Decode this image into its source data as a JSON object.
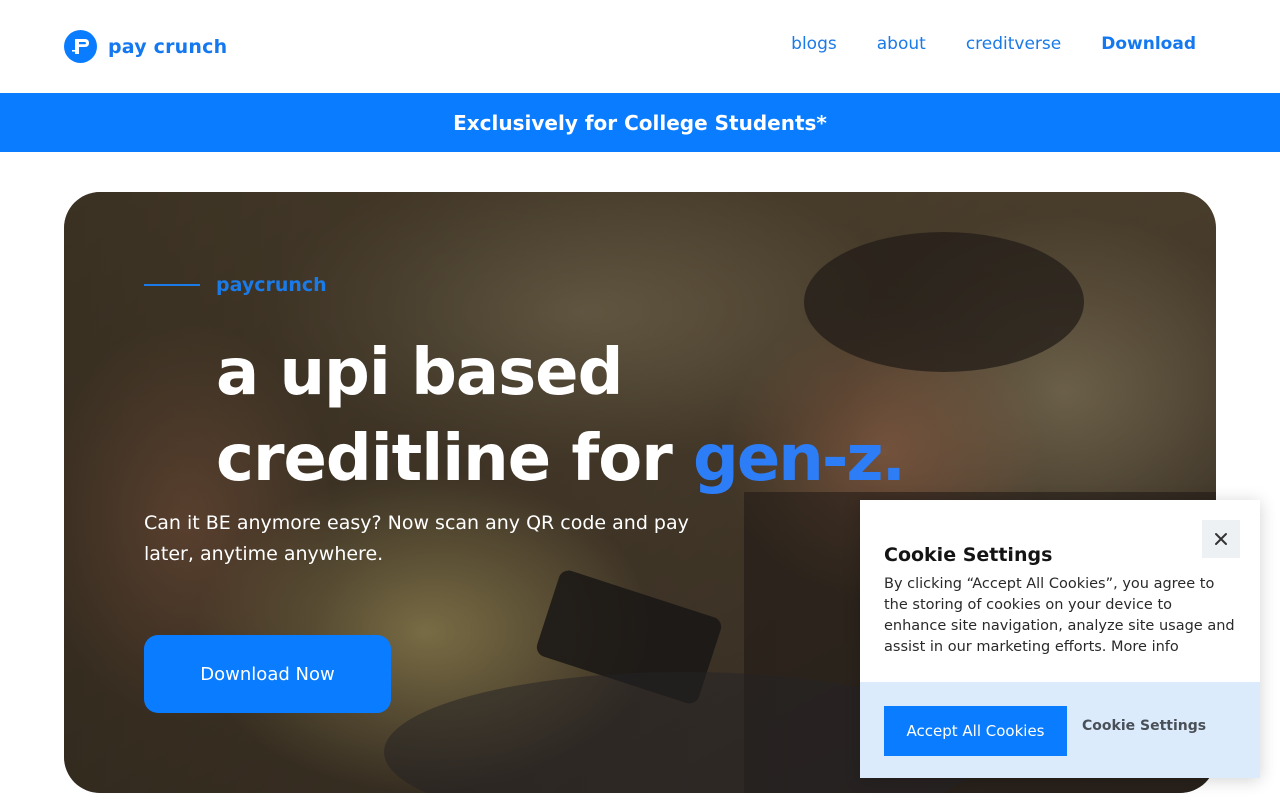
{
  "brand": {
    "name": "pay crunch",
    "color": "#1478f0"
  },
  "nav": {
    "items": [
      {
        "label": "blogs"
      },
      {
        "label": "about"
      },
      {
        "label": "creditverse"
      },
      {
        "label": "Download"
      }
    ]
  },
  "banner": {
    "text": "Exclusively for College Students*",
    "color": "#0a7cff"
  },
  "hero": {
    "eyebrow": "paycrunch",
    "headline_line1": "a upi based",
    "headline_line2_prefix": "creditline for ",
    "headline_accent": "gen-z.",
    "subtext": "Can it BE anymore easy? Now scan any QR code and pay later, anytime anywhere.",
    "cta_label": "Download Now"
  },
  "cookie": {
    "title": "Cookie Settings",
    "body": "By clicking “Accept All Cookies”, you agree to the storing of cookies on your device to enhance site navigation, analyze site usage and assist in our marketing efforts.",
    "more_link": "More info",
    "accept_label": "Accept All Cookies",
    "settings_label": "Cookie Settings",
    "close_icon": "close-icon"
  }
}
